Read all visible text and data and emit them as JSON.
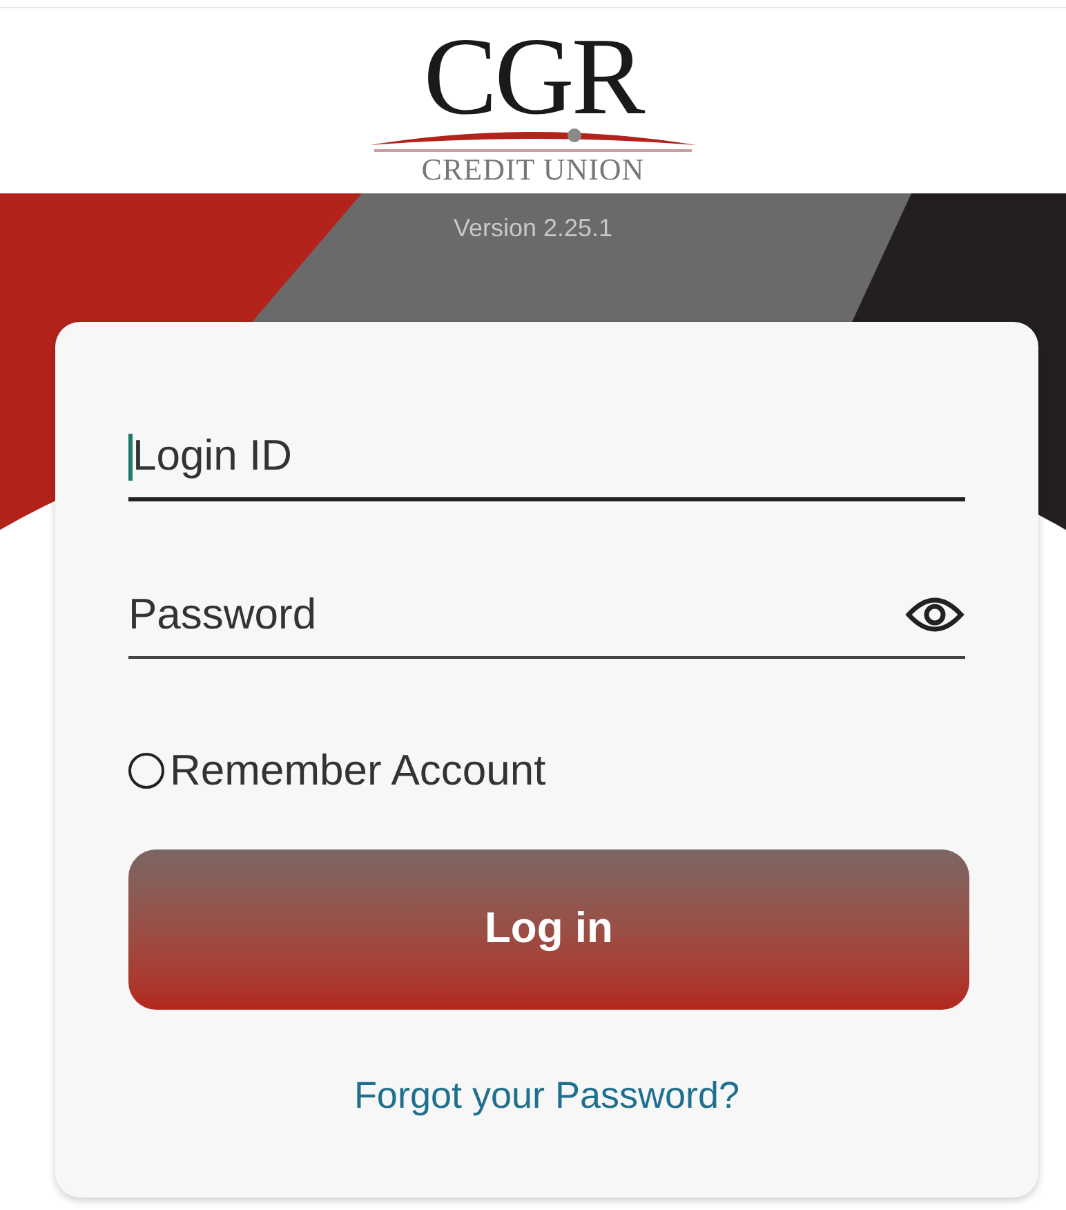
{
  "logo": {
    "name": "CGR",
    "subtitle": "CREDIT UNION"
  },
  "version": "Version 2.25.1",
  "fields": [
    {
      "kind": "text",
      "placeholder": "Login ID",
      "focused": true
    },
    {
      "kind": "password",
      "placeholder": "Password",
      "focused": false
    }
  ],
  "remember": {
    "label": "Remember Account",
    "checked": false
  },
  "login_button": "Log in",
  "forgot_link": "Forgot your Password?"
}
